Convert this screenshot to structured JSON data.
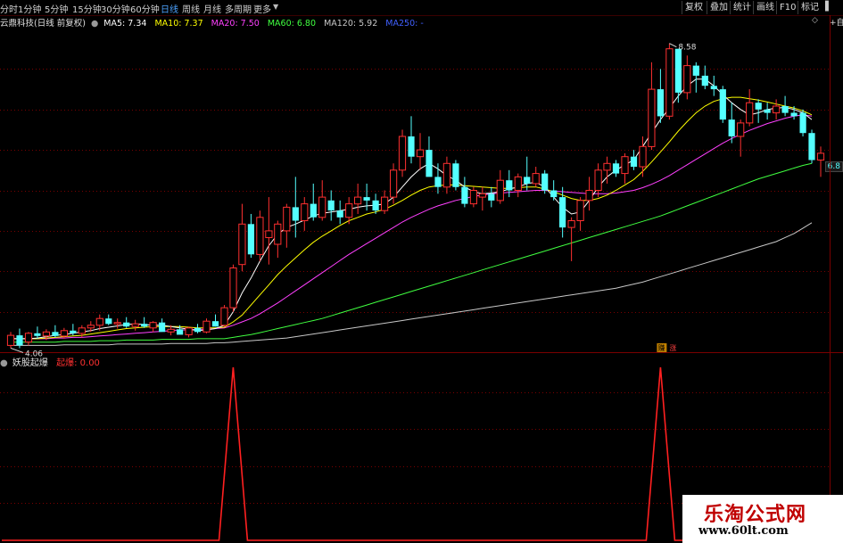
{
  "toolbar": {
    "periods": [
      "分时",
      "1分钟",
      "5分钟",
      "15分钟",
      "30分钟",
      "60分钟",
      "日线",
      "周线",
      "月线",
      "多周期",
      "更多"
    ],
    "active_period": "日线",
    "tools": [
      "复权",
      "叠加",
      "统计",
      "画线",
      "F10",
      "标记"
    ]
  },
  "stock": {
    "name": "云鼎科技(日线 前复权)",
    "ma5": "MA5: 7.34",
    "ma10": "MA10: 7.37",
    "ma20": "MA20: 7.50",
    "ma60": "MA60: 6.80",
    "ma120": "MA120: 5.92",
    "ma250": "MA250: -",
    "current_price_badge": "6.8",
    "high_label": "8.58",
    "low_label": "4.06",
    "signal_tag_1": "赚",
    "signal_tag_2": "涨",
    "side_tool": "+自选"
  },
  "indicator": {
    "name": "妖股起爆",
    "value_label": "起爆: 0.00"
  },
  "watermark": {
    "title": "乐淘公式网",
    "url": "www.60lt.com"
  },
  "colors": {
    "up": "#ff3030",
    "down": "#54ffff",
    "ma5": "#ffffff",
    "ma10": "#ffff00",
    "ma20": "#ff40ff",
    "ma60": "#40ff40",
    "ma120": "#c8c8c8",
    "ma250": "#4060ff",
    "signal": "#ff2020",
    "grid": "#7a0000"
  },
  "chart_data": {
    "type": "candlestick",
    "ylim": [
      4.0,
      8.8
    ],
    "candles": [
      {
        "o": 4.1,
        "h": 4.3,
        "l": 4.06,
        "c": 4.25
      },
      {
        "o": 4.25,
        "h": 4.35,
        "l": 4.06,
        "c": 4.1
      },
      {
        "o": 4.15,
        "h": 4.3,
        "l": 4.1,
        "c": 4.28
      },
      {
        "o": 4.28,
        "h": 4.38,
        "l": 4.2,
        "c": 4.24
      },
      {
        "o": 4.24,
        "h": 4.34,
        "l": 4.18,
        "c": 4.3
      },
      {
        "o": 4.3,
        "h": 4.4,
        "l": 4.22,
        "c": 4.24
      },
      {
        "o": 4.24,
        "h": 4.36,
        "l": 4.2,
        "c": 4.32
      },
      {
        "o": 4.32,
        "h": 4.42,
        "l": 4.25,
        "c": 4.28
      },
      {
        "o": 4.28,
        "h": 4.4,
        "l": 4.22,
        "c": 4.36
      },
      {
        "o": 4.36,
        "h": 4.46,
        "l": 4.3,
        "c": 4.4
      },
      {
        "o": 4.4,
        "h": 4.56,
        "l": 4.32,
        "c": 4.5
      },
      {
        "o": 4.5,
        "h": 4.56,
        "l": 4.4,
        "c": 4.42
      },
      {
        "o": 4.42,
        "h": 4.5,
        "l": 4.35,
        "c": 4.44
      },
      {
        "o": 4.44,
        "h": 4.52,
        "l": 4.36,
        "c": 4.38
      },
      {
        "o": 4.38,
        "h": 4.48,
        "l": 4.32,
        "c": 4.42
      },
      {
        "o": 4.42,
        "h": 4.52,
        "l": 4.36,
        "c": 4.38
      },
      {
        "o": 4.36,
        "h": 4.46,
        "l": 4.3,
        "c": 4.44
      },
      {
        "o": 4.44,
        "h": 4.5,
        "l": 4.36,
        "c": 4.3
      },
      {
        "o": 4.3,
        "h": 4.4,
        "l": 4.25,
        "c": 4.34
      },
      {
        "o": 4.34,
        "h": 4.4,
        "l": 4.28,
        "c": 4.26
      },
      {
        "o": 4.26,
        "h": 4.38,
        "l": 4.22,
        "c": 4.36
      },
      {
        "o": 4.36,
        "h": 4.42,
        "l": 4.28,
        "c": 4.3
      },
      {
        "o": 4.3,
        "h": 4.5,
        "l": 4.28,
        "c": 4.46
      },
      {
        "o": 4.46,
        "h": 4.56,
        "l": 4.38,
        "c": 4.38
      },
      {
        "o": 4.4,
        "h": 4.7,
        "l": 4.38,
        "c": 4.66
      },
      {
        "o": 4.66,
        "h": 5.3,
        "l": 4.6,
        "c": 5.25
      },
      {
        "o": 5.3,
        "h": 6.2,
        "l": 5.2,
        "c": 5.9
      },
      {
        "o": 5.9,
        "h": 6.05,
        "l": 5.4,
        "c": 5.45
      },
      {
        "o": 5.45,
        "h": 6.1,
        "l": 5.35,
        "c": 6.0
      },
      {
        "o": 5.7,
        "h": 6.3,
        "l": 5.3,
        "c": 5.8
      },
      {
        "o": 5.6,
        "h": 5.95,
        "l": 5.4,
        "c": 5.9
      },
      {
        "o": 5.8,
        "h": 6.2,
        "l": 5.55,
        "c": 6.15
      },
      {
        "o": 6.15,
        "h": 6.6,
        "l": 5.7,
        "c": 5.95
      },
      {
        "o": 5.95,
        "h": 6.3,
        "l": 5.8,
        "c": 6.2
      },
      {
        "o": 6.2,
        "h": 6.5,
        "l": 5.95,
        "c": 6.0
      },
      {
        "o": 6.0,
        "h": 6.55,
        "l": 5.95,
        "c": 6.3
      },
      {
        "o": 6.25,
        "h": 6.4,
        "l": 5.95,
        "c": 6.1
      },
      {
        "o": 6.1,
        "h": 6.25,
        "l": 5.9,
        "c": 6.0
      },
      {
        "o": 6.0,
        "h": 6.3,
        "l": 5.9,
        "c": 6.2
      },
      {
        "o": 6.2,
        "h": 6.5,
        "l": 6.05,
        "c": 6.3
      },
      {
        "o": 6.3,
        "h": 6.5,
        "l": 6.1,
        "c": 6.25
      },
      {
        "o": 6.25,
        "h": 6.35,
        "l": 6.05,
        "c": 6.1
      },
      {
        "o": 6.1,
        "h": 6.4,
        "l": 6.05,
        "c": 6.3
      },
      {
        "o": 6.3,
        "h": 6.8,
        "l": 6.2,
        "c": 6.7
      },
      {
        "o": 6.7,
        "h": 7.3,
        "l": 6.6,
        "c": 7.2
      },
      {
        "o": 7.2,
        "h": 7.5,
        "l": 6.8,
        "c": 6.9
      },
      {
        "o": 6.9,
        "h": 7.25,
        "l": 6.7,
        "c": 7.0
      },
      {
        "o": 7.0,
        "h": 7.2,
        "l": 6.8,
        "c": 6.6
      },
      {
        "o": 6.6,
        "h": 6.8,
        "l": 6.35,
        "c": 6.45
      },
      {
        "o": 6.45,
        "h": 6.9,
        "l": 6.35,
        "c": 6.8
      },
      {
        "o": 6.8,
        "h": 6.85,
        "l": 6.4,
        "c": 6.45
      },
      {
        "o": 6.45,
        "h": 6.6,
        "l": 6.15,
        "c": 6.2
      },
      {
        "o": 6.2,
        "h": 6.45,
        "l": 6.15,
        "c": 6.4
      },
      {
        "o": 6.3,
        "h": 6.45,
        "l": 6.1,
        "c": 6.35
      },
      {
        "o": 6.35,
        "h": 6.45,
        "l": 6.15,
        "c": 6.25
      },
      {
        "o": 6.25,
        "h": 6.7,
        "l": 6.2,
        "c": 6.55
      },
      {
        "o": 6.55,
        "h": 6.7,
        "l": 6.3,
        "c": 6.4
      },
      {
        "o": 6.4,
        "h": 6.65,
        "l": 6.3,
        "c": 6.6
      },
      {
        "o": 6.6,
        "h": 6.9,
        "l": 6.4,
        "c": 6.5
      },
      {
        "o": 6.5,
        "h": 6.75,
        "l": 6.45,
        "c": 6.65
      },
      {
        "o": 6.65,
        "h": 6.7,
        "l": 6.35,
        "c": 6.4
      },
      {
        "o": 6.4,
        "h": 6.55,
        "l": 6.25,
        "c": 6.3
      },
      {
        "o": 6.3,
        "h": 6.45,
        "l": 5.7,
        "c": 5.85
      },
      {
        "o": 5.85,
        "h": 6.0,
        "l": 5.35,
        "c": 5.95
      },
      {
        "o": 5.95,
        "h": 6.3,
        "l": 5.8,
        "c": 6.25
      },
      {
        "o": 6.25,
        "h": 6.6,
        "l": 6.1,
        "c": 6.4
      },
      {
        "o": 6.4,
        "h": 6.8,
        "l": 6.3,
        "c": 6.7
      },
      {
        "o": 6.7,
        "h": 6.9,
        "l": 6.5,
        "c": 6.8
      },
      {
        "o": 6.8,
        "h": 6.85,
        "l": 6.6,
        "c": 6.65
      },
      {
        "o": 6.65,
        "h": 6.95,
        "l": 6.5,
        "c": 6.9
      },
      {
        "o": 6.9,
        "h": 7.0,
        "l": 6.7,
        "c": 6.75
      },
      {
        "o": 6.75,
        "h": 7.2,
        "l": 6.6,
        "c": 7.05
      },
      {
        "o": 7.05,
        "h": 8.3,
        "l": 7.0,
        "c": 7.9
      },
      {
        "o": 7.9,
        "h": 8.2,
        "l": 7.4,
        "c": 7.5
      },
      {
        "o": 7.5,
        "h": 8.58,
        "l": 7.45,
        "c": 8.5
      },
      {
        "o": 8.5,
        "h": 8.5,
        "l": 7.7,
        "c": 7.85
      },
      {
        "o": 7.85,
        "h": 8.4,
        "l": 7.75,
        "c": 8.25
      },
      {
        "o": 8.25,
        "h": 8.3,
        "l": 7.85,
        "c": 8.1
      },
      {
        "o": 8.1,
        "h": 8.25,
        "l": 7.9,
        "c": 7.95
      },
      {
        "o": 7.95,
        "h": 8.1,
        "l": 7.8,
        "c": 7.9
      },
      {
        "o": 7.9,
        "h": 7.95,
        "l": 7.4,
        "c": 7.45
      },
      {
        "o": 7.45,
        "h": 7.7,
        "l": 7.1,
        "c": 7.2
      },
      {
        "o": 7.2,
        "h": 7.45,
        "l": 6.9,
        "c": 7.4
      },
      {
        "o": 7.4,
        "h": 7.9,
        "l": 7.35,
        "c": 7.7
      },
      {
        "o": 7.7,
        "h": 7.75,
        "l": 7.4,
        "c": 7.6
      },
      {
        "o": 7.6,
        "h": 7.7,
        "l": 7.45,
        "c": 7.55
      },
      {
        "o": 7.55,
        "h": 7.75,
        "l": 7.45,
        "c": 7.65
      },
      {
        "o": 7.65,
        "h": 7.8,
        "l": 7.5,
        "c": 7.55
      },
      {
        "o": 7.55,
        "h": 7.65,
        "l": 7.45,
        "c": 7.5
      },
      {
        "o": 7.55,
        "h": 7.6,
        "l": 7.2,
        "c": 7.25
      },
      {
        "o": 7.25,
        "h": 7.3,
        "l": 6.8,
        "c": 6.85
      },
      {
        "o": 6.85,
        "h": 7.05,
        "l": 6.6,
        "c": 6.95
      }
    ],
    "ma5": [
      4.2,
      4.2,
      4.2,
      4.21,
      4.23,
      4.25,
      4.26,
      4.28,
      4.3,
      4.32,
      4.35,
      4.37,
      4.39,
      4.41,
      4.42,
      4.41,
      4.4,
      4.4,
      4.38,
      4.36,
      4.34,
      4.32,
      4.33,
      4.35,
      4.4,
      4.6,
      4.88,
      5.1,
      5.35,
      5.58,
      5.75,
      5.85,
      5.9,
      5.96,
      6.02,
      6.06,
      6.08,
      6.1,
      6.12,
      6.15,
      6.17,
      6.18,
      6.2,
      6.3,
      6.45,
      6.6,
      6.72,
      6.8,
      6.72,
      6.62,
      6.55,
      6.45,
      6.38,
      6.35,
      6.36,
      6.38,
      6.42,
      6.45,
      6.5,
      6.52,
      6.45,
      6.3,
      6.15,
      6.05,
      6.08,
      6.25,
      6.45,
      6.6,
      6.7,
      6.78,
      6.85,
      7.05,
      7.25,
      7.45,
      7.62,
      7.8,
      7.95,
      8.05,
      8.05,
      7.95,
      7.82,
      7.7,
      7.6,
      7.52,
      7.55,
      7.6,
      7.62,
      7.63,
      7.6,
      7.55,
      7.45
    ],
    "ma10": [
      4.2,
      4.2,
      4.2,
      4.2,
      4.21,
      4.22,
      4.23,
      4.24,
      4.25,
      4.27,
      4.29,
      4.31,
      4.33,
      4.35,
      4.36,
      4.37,
      4.38,
      4.38,
      4.38,
      4.38,
      4.37,
      4.36,
      4.36,
      4.36,
      4.37,
      4.45,
      4.55,
      4.7,
      4.85,
      5.0,
      5.15,
      5.28,
      5.4,
      5.52,
      5.63,
      5.72,
      5.8,
      5.88,
      5.95,
      6.0,
      6.05,
      6.08,
      6.12,
      6.18,
      6.25,
      6.33,
      6.4,
      6.45,
      6.47,
      6.48,
      6.48,
      6.47,
      6.46,
      6.45,
      6.44,
      6.43,
      6.43,
      6.44,
      6.45,
      6.45,
      6.42,
      6.38,
      6.33,
      6.28,
      6.25,
      6.25,
      6.28,
      6.33,
      6.4,
      6.48,
      6.56,
      6.68,
      6.82,
      6.97,
      7.12,
      7.28,
      7.42,
      7.55,
      7.65,
      7.72,
      7.76,
      7.78,
      7.78,
      7.76,
      7.74,
      7.71,
      7.68,
      7.65,
      7.62,
      7.58,
      7.52
    ],
    "ma20": [
      4.2,
      4.2,
      4.2,
      4.2,
      4.2,
      4.21,
      4.21,
      4.22,
      4.22,
      4.23,
      4.24,
      4.25,
      4.26,
      4.27,
      4.28,
      4.29,
      4.3,
      4.31,
      4.32,
      4.33,
      4.33,
      4.34,
      4.34,
      4.35,
      4.36,
      4.4,
      4.45,
      4.5,
      4.57,
      4.65,
      4.73,
      4.82,
      4.91,
      5.0,
      5.09,
      5.18,
      5.27,
      5.36,
      5.45,
      5.53,
      5.61,
      5.69,
      5.77,
      5.85,
      5.93,
      6.0,
      6.06,
      6.12,
      6.17,
      6.21,
      6.25,
      6.28,
      6.31,
      6.33,
      6.35,
      6.36,
      6.37,
      6.38,
      6.39,
      6.4,
      6.4,
      6.39,
      6.38,
      6.37,
      6.36,
      6.35,
      6.35,
      6.35,
      6.36,
      6.38,
      6.4,
      6.44,
      6.49,
      6.55,
      6.62,
      6.7,
      6.78,
      6.86,
      6.94,
      7.02,
      7.1,
      7.17,
      7.23,
      7.29,
      7.34,
      7.39,
      7.43,
      7.47,
      7.5,
      7.52,
      7.5
    ],
    "ma60": [
      4.15,
      4.15,
      4.15,
      4.15,
      4.15,
      4.15,
      4.16,
      4.16,
      4.16,
      4.16,
      4.17,
      4.17,
      4.17,
      4.18,
      4.18,
      4.18,
      4.18,
      4.19,
      4.19,
      4.19,
      4.19,
      4.2,
      4.2,
      4.2,
      4.2,
      4.22,
      4.24,
      4.26,
      4.29,
      4.32,
      4.35,
      4.38,
      4.41,
      4.44,
      4.47,
      4.5,
      4.54,
      4.58,
      4.62,
      4.66,
      4.7,
      4.74,
      4.78,
      4.82,
      4.86,
      4.9,
      4.94,
      4.98,
      5.02,
      5.06,
      5.1,
      5.14,
      5.18,
      5.22,
      5.26,
      5.3,
      5.34,
      5.38,
      5.42,
      5.46,
      5.5,
      5.54,
      5.58,
      5.62,
      5.66,
      5.7,
      5.74,
      5.78,
      5.82,
      5.86,
      5.9,
      5.94,
      5.98,
      6.02,
      6.07,
      6.12,
      6.17,
      6.22,
      6.27,
      6.32,
      6.37,
      6.42,
      6.47,
      6.52,
      6.57,
      6.61,
      6.65,
      6.69,
      6.73,
      6.77,
      6.8
    ],
    "ma120": [
      4.1,
      4.1,
      4.1,
      4.1,
      4.1,
      4.1,
      4.11,
      4.11,
      4.11,
      4.11,
      4.11,
      4.11,
      4.12,
      4.12,
      4.12,
      4.12,
      4.12,
      4.12,
      4.13,
      4.13,
      4.13,
      4.13,
      4.13,
      4.14,
      4.14,
      4.15,
      4.16,
      4.17,
      4.18,
      4.19,
      4.2,
      4.21,
      4.23,
      4.25,
      4.27,
      4.29,
      4.31,
      4.33,
      4.35,
      4.37,
      4.39,
      4.41,
      4.43,
      4.45,
      4.47,
      4.49,
      4.51,
      4.53,
      4.55,
      4.57,
      4.59,
      4.61,
      4.63,
      4.65,
      4.67,
      4.69,
      4.71,
      4.73,
      4.75,
      4.77,
      4.79,
      4.81,
      4.83,
      4.85,
      4.87,
      4.89,
      4.91,
      4.93,
      4.95,
      4.98,
      5.01,
      5.04,
      5.08,
      5.12,
      5.16,
      5.2,
      5.24,
      5.28,
      5.32,
      5.36,
      5.4,
      5.44,
      5.48,
      5.52,
      5.56,
      5.6,
      5.64,
      5.7,
      5.76,
      5.84,
      5.92
    ],
    "signal_ylim": [
      0,
      1
    ],
    "signal": [
      0,
      0,
      0,
      0,
      0,
      0,
      0,
      0,
      0,
      0,
      0,
      0,
      0,
      0,
      0,
      0,
      0,
      0,
      0,
      0,
      0,
      0,
      0,
      0,
      0,
      1,
      0,
      0,
      0,
      0,
      0,
      0,
      0,
      0,
      0,
      0,
      0,
      0,
      0,
      0,
      0,
      0,
      0,
      0,
      0,
      0,
      0,
      0,
      0,
      0,
      0,
      0,
      0,
      0,
      0,
      0,
      0,
      0,
      0,
      0,
      0,
      0,
      0,
      0,
      0,
      0,
      0,
      0,
      0,
      0,
      0,
      0,
      0,
      1,
      0,
      0,
      0,
      0,
      0,
      0,
      0,
      0,
      0,
      0,
      0,
      0,
      0,
      0,
      0,
      0,
      0
    ]
  }
}
